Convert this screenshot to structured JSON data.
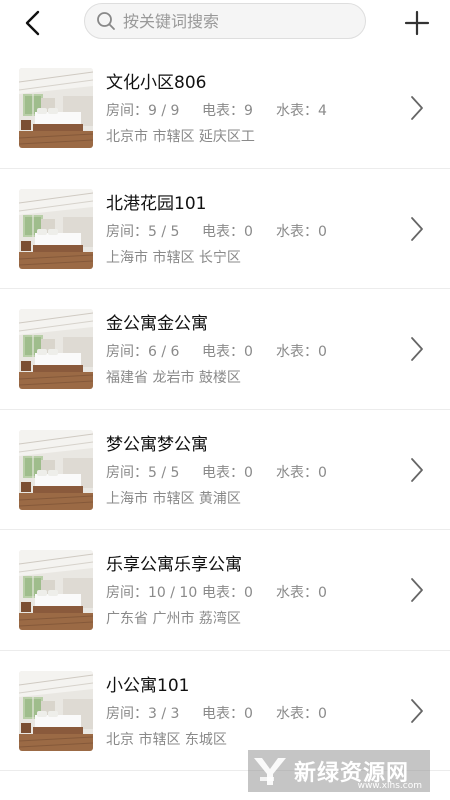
{
  "header": {
    "search_placeholder": "按关键词搜索"
  },
  "labels": {
    "rooms": "房间：",
    "electric": "电表：",
    "water": "水表："
  },
  "properties": [
    {
      "name": "文化小区806",
      "rooms": "9 / 9",
      "electric": "9",
      "water": "4",
      "address": "北京市 市辖区 延庆区工"
    },
    {
      "name": "北港花园101",
      "rooms": "5 / 5",
      "electric": "0",
      "water": "0",
      "address": "上海市 市辖区 长宁区"
    },
    {
      "name": "金公寓金公寓",
      "rooms": "6 / 6",
      "electric": "0",
      "water": "0",
      "address": "福建省 龙岩市 鼓楼区"
    },
    {
      "name": "梦公寓梦公寓",
      "rooms": "5 / 5",
      "electric": "0",
      "water": "0",
      "address": "上海市 市辖区 黄浦区"
    },
    {
      "name": "乐享公寓乐享公寓",
      "rooms": "10 / 10",
      "electric": "0",
      "water": "0",
      "address": "广东省 广州市 荔湾区"
    },
    {
      "name": "小公寓101",
      "rooms": "3 / 3",
      "electric": "0",
      "water": "0",
      "address": "北京 市辖区 东城区"
    }
  ],
  "watermark": {
    "text": "新绿资源网",
    "sub": "www.xlhs.com"
  }
}
